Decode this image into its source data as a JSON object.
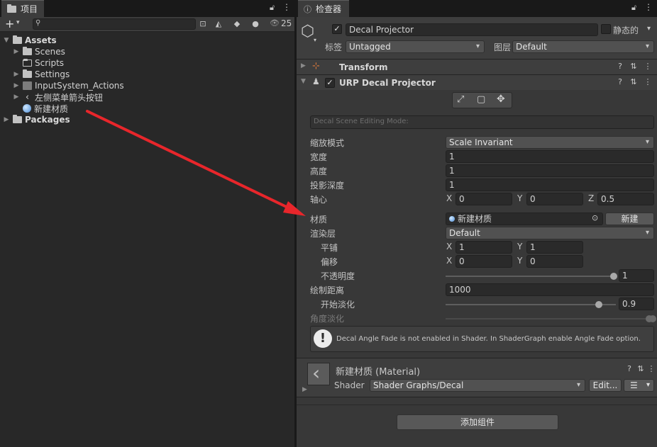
{
  "project": {
    "tab_label": "项目",
    "add_label": "+",
    "eye_count": "25",
    "tree": {
      "assets": "Assets",
      "scenes": "Scenes",
      "scripts": "Scripts",
      "settings": "Settings",
      "input_actions": "InputSystem_Actions",
      "arrow_button": "左侧菜单箭头按钮",
      "new_material": "新建材质",
      "packages": "Packages"
    }
  },
  "inspector": {
    "tab_label": "检查器",
    "object_name": "Decal Projector",
    "static_label": "静态的",
    "tag_label": "标签",
    "tag_value": "Untagged",
    "layer_label": "图层",
    "layer_value": "Default",
    "transform": {
      "title": "Transform"
    },
    "decal": {
      "title": "URP Decal Projector",
      "edit_mode_label": "Decal Scene Editing Mode:",
      "scale_mode_label": "缩放模式",
      "scale_mode_value": "Scale Invariant",
      "width_label": "宽度",
      "width_value": "1",
      "height_label": "高度",
      "height_value": "1",
      "depth_label": "投影深度",
      "depth_value": "1",
      "pivot_label": "轴心",
      "pivot": {
        "x_axis": "X",
        "x": "0",
        "y_axis": "Y",
        "y": "0",
        "z_axis": "Z",
        "z": "0.5"
      },
      "material_label": "材质",
      "material_value": "新建材质",
      "new_button": "新建",
      "render_layer_label": "渲染层",
      "render_layer_value": "Default",
      "tiling_label": "平铺",
      "tiling": {
        "x_axis": "X",
        "x": "1",
        "y_axis": "Y",
        "y": "1"
      },
      "offset_label": "偏移",
      "offset": {
        "x_axis": "X",
        "x": "0",
        "y_axis": "Y",
        "y": "0"
      },
      "opacity_label": "不透明度",
      "opacity_value": "1",
      "opacity_fraction": 1.0,
      "draw_distance_label": "绘制距离",
      "draw_distance_value": "1000",
      "start_fade_label": "开始淡化",
      "start_fade_value": "0.9",
      "start_fade_fraction": 0.9,
      "angle_fade_label": "角度淡化",
      "warning_text": "Decal Angle Fade is not enabled in Shader. In ShaderGraph enable Angle Fade option."
    },
    "material": {
      "title": "新建材质 (Material)",
      "shader_label": "Shader",
      "shader_value": "Shader Graphs/Decal",
      "edit_button": "Edit...",
      "menu_button": "☰"
    },
    "add_component_button": "添加组件"
  },
  "colors": {
    "annotation_arrow": "#e8262b",
    "accent_blue": "#4c8cd6"
  }
}
